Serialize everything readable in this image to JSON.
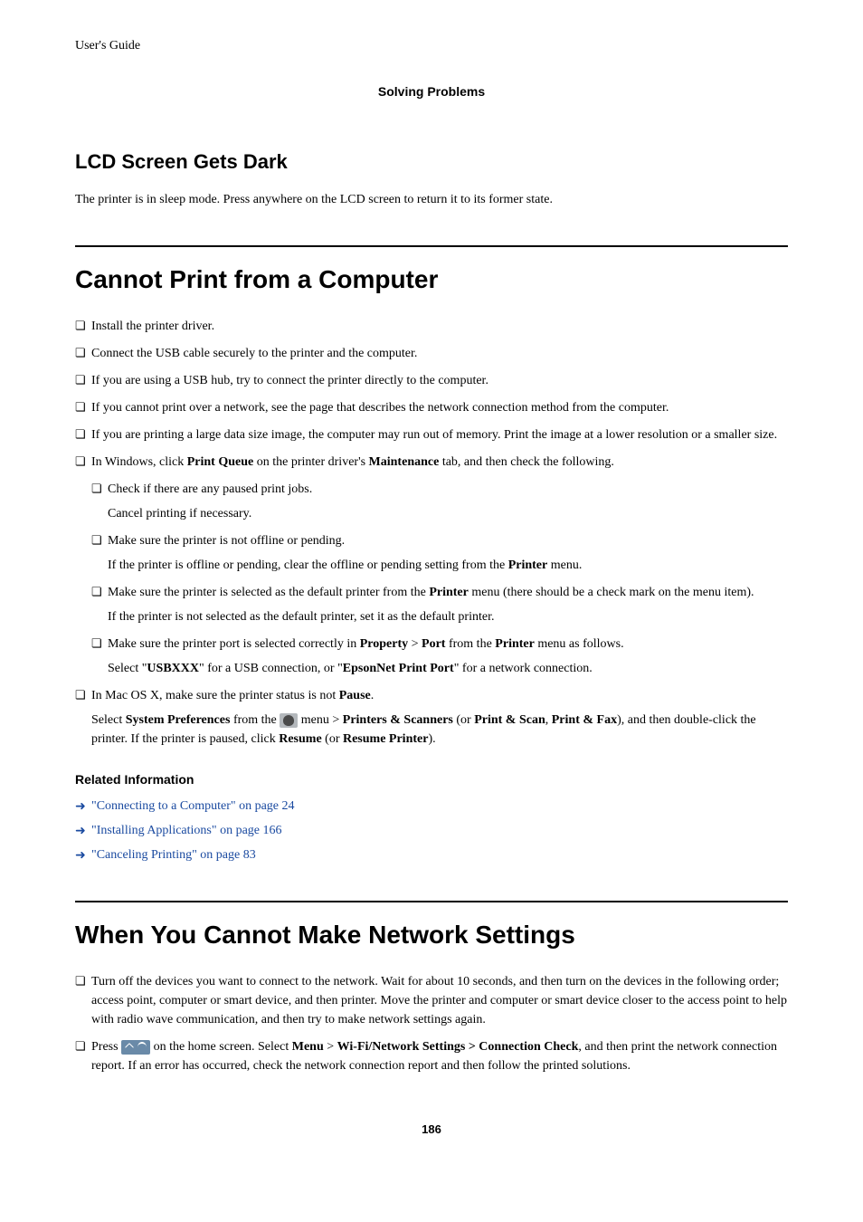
{
  "header": {
    "top": "User's Guide",
    "center": "Solving Problems"
  },
  "section1": {
    "heading": "LCD Screen Gets Dark",
    "body": "The printer is in sleep mode. Press anywhere on the LCD screen to return it to its former state."
  },
  "section2": {
    "heading": "Cannot Print from a Computer",
    "items": {
      "i1": "Install the printer driver.",
      "i2": "Connect the USB cable securely to the printer and the computer.",
      "i3": "If you are using a USB hub, try to connect the printer directly to the computer.",
      "i4": "If you cannot print over a network, see the page that describes the network connection method from the computer.",
      "i5": "If you are printing a large data size image, the computer may run out of memory. Print the image at a lower resolution or a smaller size.",
      "i6_pre": "In Windows, click ",
      "i6_b1": "Print Queue",
      "i6_mid": " on the printer driver's ",
      "i6_b2": "Maintenance",
      "i6_post": " tab, and then check the following.",
      "i6a": "Check if there are any paused print jobs.",
      "i6a_sub": "Cancel printing if necessary.",
      "i6b": "Make sure the printer is not offline or pending.",
      "i6b_sub_pre": "If the printer is offline or pending, clear the offline or pending setting from the ",
      "i6b_sub_b": "Printer",
      "i6b_sub_post": " menu.",
      "i6c_pre": "Make sure the printer is selected as the default printer from the ",
      "i6c_b": "Printer",
      "i6c_post": " menu (there should be a check mark on the menu item).",
      "i6c_sub": "If the printer is not selected as the default printer, set it as the default printer.",
      "i6d_pre": "Make sure the printer port is selected correctly in ",
      "i6d_b1": "Property",
      "i6d_gt": " > ",
      "i6d_b2": "Port",
      "i6d_mid": " from the ",
      "i6d_b3": "Printer",
      "i6d_post": " menu as follows.",
      "i6d_sub_pre": "Select \"",
      "i6d_sub_b1": "USBXXX",
      "i6d_sub_mid": "\" for a USB connection, or \"",
      "i6d_sub_b2": "EpsonNet Print Port",
      "i6d_sub_post": "\" for a network connection.",
      "i7_pre": "In Mac OS X, make sure the printer status is not ",
      "i7_b": "Pause",
      "i7_post": ".",
      "i7_sub_pre": "Select ",
      "i7_sub_b1": "System Preferences",
      "i7_sub_mid1": " from the ",
      "i7_sub_mid2": " menu > ",
      "i7_sub_b2": "Printers & Scanners",
      "i7_sub_mid3": " (or ",
      "i7_sub_b3": "Print & Scan",
      "i7_sub_mid4": ", ",
      "i7_sub_b4": "Print & Fax",
      "i7_sub_mid5": "), and then double-click the printer. If the printer is paused, click ",
      "i7_sub_b5": "Resume",
      "i7_sub_mid6": " (or ",
      "i7_sub_b6": "Resume Printer",
      "i7_sub_post": ")."
    },
    "related_heading": "Related Information",
    "related": {
      "r1": "\"Connecting to a Computer\" on page 24",
      "r2": "\"Installing Applications\" on page 166",
      "r3": "\"Canceling Printing\" on page 83"
    }
  },
  "section3": {
    "heading": "When You Cannot Make Network Settings",
    "items": {
      "i1": "Turn off the devices you want to connect to the network. Wait for about 10 seconds, and then turn on the devices in the following order; access point, computer or smart device, and then printer. Move the printer and computer or smart device closer to the access point to help with radio wave communication, and then try to make network settings again.",
      "i2_pre": "Press ",
      "i2_mid1": " on the home screen. Select ",
      "i2_b1": "Menu",
      "i2_gt1": " > ",
      "i2_b2": "Wi-Fi/Network Settings > Connection Check",
      "i2_post": ", and then print the network connection report. If an error has occurred, check the network connection report and then follow the printed solutions."
    }
  },
  "page_number": "186"
}
